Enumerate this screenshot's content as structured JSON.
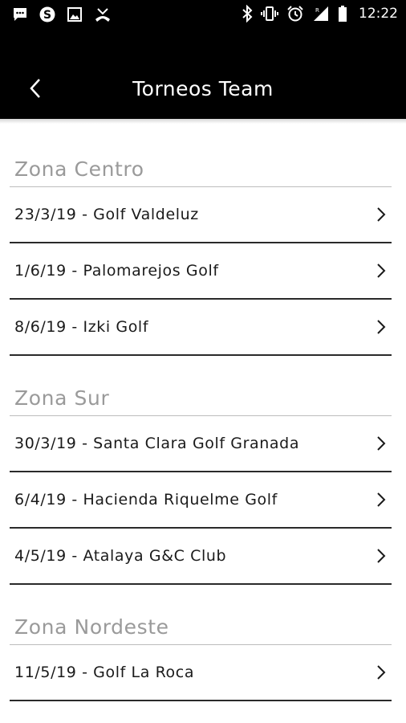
{
  "status_bar": {
    "time": "12:22",
    "left_icons": [
      "message-icon",
      "skype-icon",
      "image-icon",
      "missed-call-icon"
    ],
    "right_icons": [
      "bluetooth-icon",
      "vibrate-icon",
      "alarm-icon",
      "signal-icon",
      "battery-icon"
    ]
  },
  "header": {
    "title": "Torneos Team",
    "back_icon": "chevron-left-icon"
  },
  "zones": [
    {
      "title": "Zona Centro",
      "items": [
        {
          "label": "23/3/19 - Golf Valdeluz"
        },
        {
          "label": "1/6/19 - Palomarejos Golf"
        },
        {
          "label": "8/6/19 - Izki Golf"
        }
      ]
    },
    {
      "title": "Zona Sur",
      "items": [
        {
          "label": "30/3/19 - Santa Clara Golf Granada"
        },
        {
          "label": "6/4/19 - Hacienda Riquelme Golf"
        },
        {
          "label": "4/5/19 - Atalaya G&C Club"
        }
      ]
    },
    {
      "title": "Zona Nordeste",
      "items": [
        {
          "label": "11/5/19 - Golf La Roca"
        }
      ]
    }
  ],
  "colors": {
    "app_bar": "#000000",
    "zone_header_text": "#9a9a9a",
    "row_divider": "#2a2a2a"
  }
}
